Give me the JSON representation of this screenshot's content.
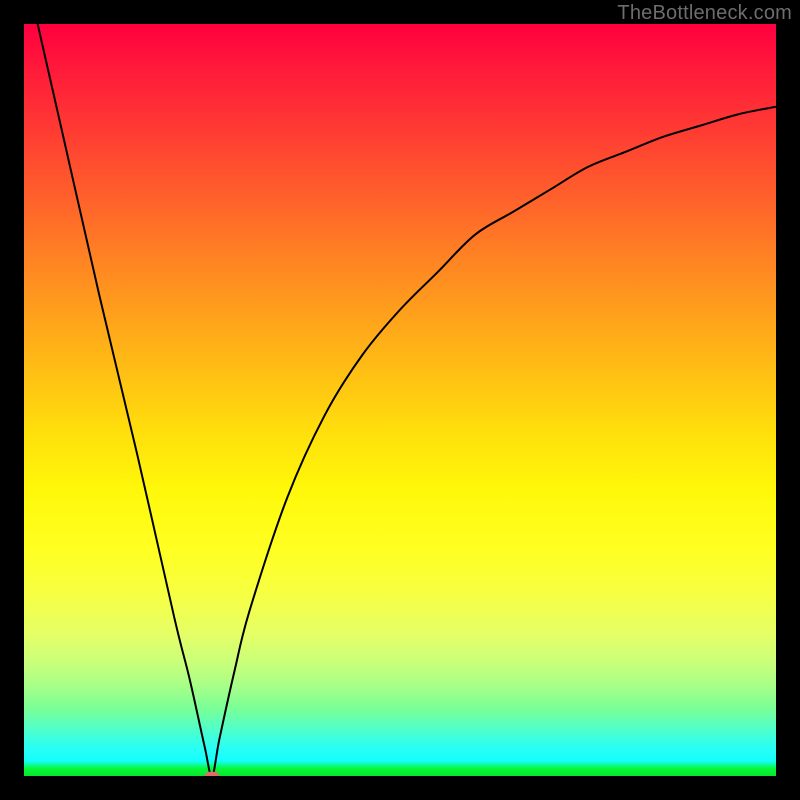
{
  "watermark": "TheBottleneck.com",
  "colors": {
    "background": "#000000",
    "curve": "#000000",
    "marker": "#e26b69",
    "watermark": "#6d6d6d"
  },
  "chart_data": {
    "type": "line",
    "title": "",
    "xlabel": "",
    "ylabel": "",
    "xlim": [
      0,
      100
    ],
    "ylim": [
      0,
      100
    ],
    "grid": false,
    "legend": false,
    "series": [
      {
        "name": "bottleneck-curve",
        "x": [
          0,
          5,
          10,
          15,
          20,
          22,
          24,
          25,
          26,
          28,
          30,
          35,
          40,
          45,
          50,
          55,
          60,
          65,
          70,
          75,
          80,
          85,
          90,
          95,
          100
        ],
        "y": [
          108,
          86,
          64,
          43,
          21,
          13,
          4,
          0,
          5,
          14,
          22,
          37,
          48,
          56,
          62,
          67,
          72,
          75,
          78,
          81,
          83,
          85,
          86.5,
          88,
          89
        ]
      }
    ],
    "marker": {
      "x": 25,
      "y": 0,
      "rx": 1.0,
      "ry": 0.6
    },
    "description": "V-shaped bottleneck percentage curve with sharp minimum near x≈25, rising asymptotically toward the right. Background is a red→yellow→green vertical gradient."
  }
}
